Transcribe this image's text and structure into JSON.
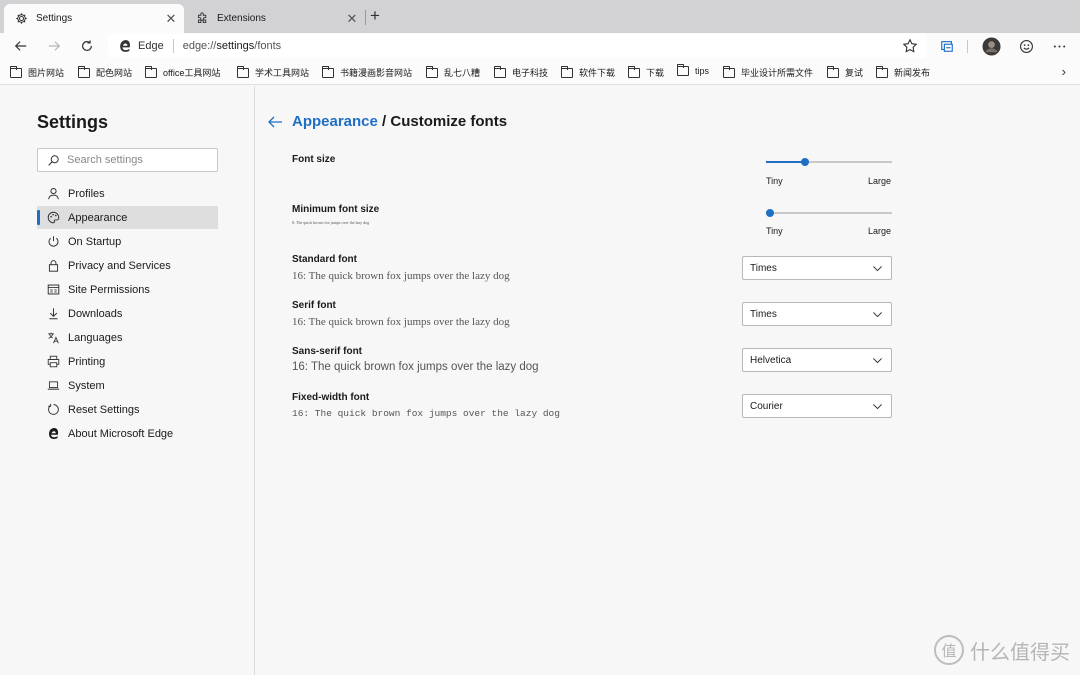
{
  "tabs": [
    {
      "title": "Settings",
      "icon": "gear-icon",
      "active": true
    },
    {
      "title": "Extensions",
      "icon": "puzzle-icon",
      "active": false
    }
  ],
  "toolbar": {
    "address_label": "Edge",
    "url_prefix": "edge://",
    "url_main": "settings",
    "url_suffix": "/fonts"
  },
  "bookmarks": [
    "图片网站",
    "配色网站",
    "office工具网站",
    "学术工具网站",
    "书籍漫画影音网站",
    "乱七八糟",
    "电子科技",
    "软件下载",
    "下载",
    "tips",
    "毕业设计所需文件",
    "复试",
    "新闻发布"
  ],
  "nav": {
    "title": "Settings",
    "search_placeholder": "Search settings",
    "items": [
      {
        "label": "Profiles",
        "icon": "person-icon"
      },
      {
        "label": "Appearance",
        "icon": "palette-icon",
        "selected": true
      },
      {
        "label": "On Startup",
        "icon": "power-icon"
      },
      {
        "label": "Privacy and Services",
        "icon": "lock-icon"
      },
      {
        "label": "Site Permissions",
        "icon": "site-permissions-icon"
      },
      {
        "label": "Downloads",
        "icon": "download-icon"
      },
      {
        "label": "Languages",
        "icon": "languages-icon"
      },
      {
        "label": "Printing",
        "icon": "printer-icon"
      },
      {
        "label": "System",
        "icon": "laptop-icon"
      },
      {
        "label": "Reset Settings",
        "icon": "reset-icon"
      },
      {
        "label": "About Microsoft Edge",
        "icon": "edge-logo-icon"
      }
    ]
  },
  "main": {
    "breadcrumb_link": "Appearance",
    "breadcrumb_sep": " / ",
    "breadcrumb_current": "Customize fonts",
    "font_size": {
      "label": "Font size",
      "min_label": "Tiny",
      "max_label": "Large",
      "value_fraction": 0.3
    },
    "min_font_size": {
      "label": "Minimum font size",
      "sample": "0: The quick brown fox jumps over the lazy dog",
      "min_label": "Tiny",
      "max_label": "Large",
      "value_fraction": 0.0
    },
    "standard_font": {
      "label": "Standard font",
      "sample": "16: The quick brown fox jumps over the lazy dog",
      "value": "Times"
    },
    "serif_font": {
      "label": "Serif font",
      "sample": "16: The quick brown fox jumps over the lazy dog",
      "value": "Times"
    },
    "sans_serif_font": {
      "label": "Sans-serif font",
      "sample": "16: The quick brown fox jumps over the lazy dog",
      "value": "Helvetica"
    },
    "fixed_width_font": {
      "label": "Fixed-width font",
      "sample": "16: The quick brown fox jumps over the lazy dog",
      "value": "Courier"
    }
  },
  "watermark": {
    "text": "什么值得买",
    "logo_text": "值"
  },
  "colors": {
    "accent": "#1f6fc5",
    "selected_bg": "#dedede",
    "tabstrip_bg": "#d2d2d4"
  }
}
